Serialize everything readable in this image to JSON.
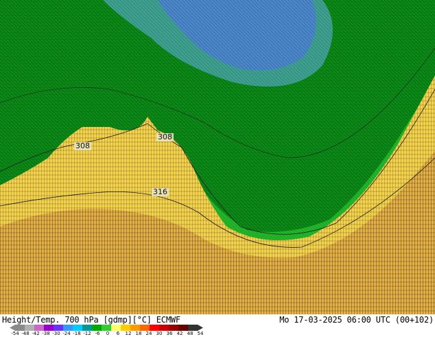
{
  "title": "Height/Temp. 700 hPa [gdmp][°C] ECMWF",
  "datetime": "Mo 17-03-2025 06:00 UTC (00+102)",
  "contour_labels": [
    "308",
    "308",
    "316"
  ],
  "colorbar": {
    "ticks": [
      "-54",
      "-48",
      "-42",
      "-38",
      "-30",
      "-24",
      "-18",
      "-12",
      "-6",
      "0",
      "6",
      "12",
      "18",
      "24",
      "30",
      "36",
      "42",
      "48",
      "54"
    ],
    "colors": [
      "#8a8a8a",
      "#b0b0b0",
      "#cc66cc",
      "#9900cc",
      "#6633ff",
      "#3399ff",
      "#00ccff",
      "#009999",
      "#00aa00",
      "#33cc33",
      "#ffff66",
      "#ffcc00",
      "#ff9900",
      "#ff6600",
      "#ff0000",
      "#cc0000",
      "#990000",
      "#660000",
      "#333333"
    ]
  },
  "map_colors": {
    "dark_green": "#0a7a0a",
    "mid_green": "#12a312",
    "light_green": "#2fcf2f",
    "teal": "#2e8f8f",
    "blue": "#3a6ec9",
    "yellow": "#f5e05a",
    "orange": "#e8b54a"
  }
}
